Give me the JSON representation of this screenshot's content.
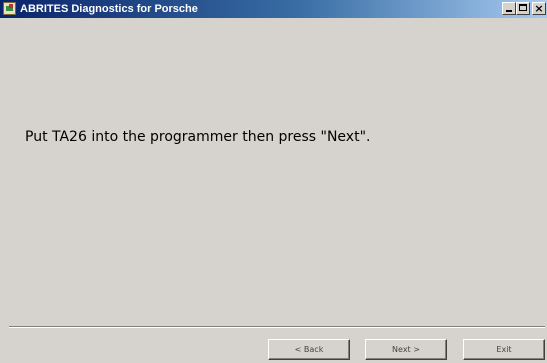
{
  "window": {
    "title": "ABRITES Diagnostics for Porsche",
    "controls": {
      "minimize": "_",
      "maximize": "□",
      "close": "×"
    }
  },
  "main": {
    "message": "Put TA26 into the programmer then press \"Next\"."
  },
  "footer": {
    "back_label": "< Back",
    "next_label": "Next >",
    "exit_label": "Exit"
  },
  "colors": {
    "titlebar_start": "#0a246a",
    "titlebar_end": "#a6caf0",
    "background": "#d6d3ce"
  },
  "icons": {
    "app": "abrites-app-icon",
    "minimize": "minimize-icon",
    "maximize": "maximize-icon",
    "close": "close-icon"
  }
}
